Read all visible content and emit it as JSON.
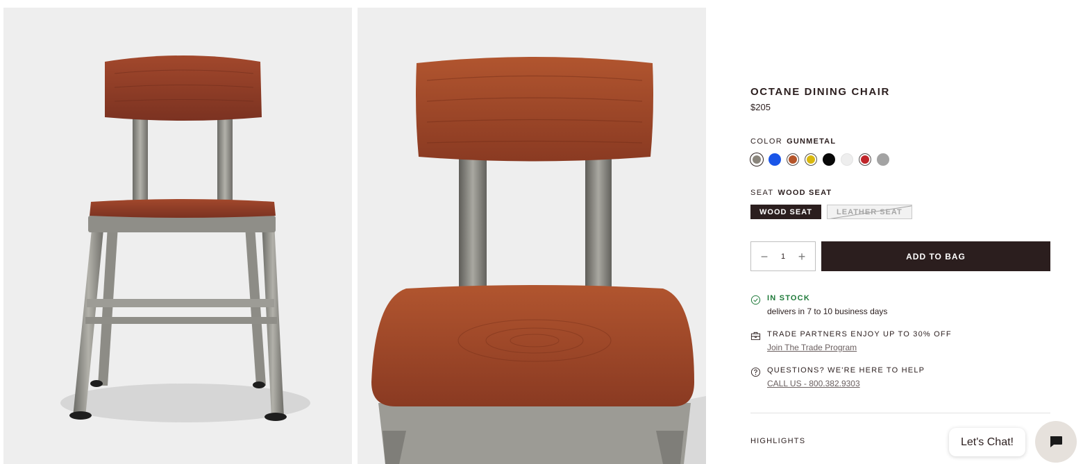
{
  "product": {
    "title": "OCTANE DINING CHAIR",
    "price": "$205"
  },
  "color_option": {
    "label": "COLOR",
    "selected": "GUNMETAL",
    "swatches": [
      {
        "name": "gunmetal",
        "color": "#8a857c",
        "selected": true
      },
      {
        "name": "blue",
        "color": "#1a55e8"
      },
      {
        "name": "copper",
        "color": "#b5552a"
      },
      {
        "name": "yellow",
        "color": "#d9b80f"
      },
      {
        "name": "black",
        "color": "#080808"
      },
      {
        "name": "white",
        "color": "#eeeeee"
      },
      {
        "name": "red",
        "color": "#c0252a"
      },
      {
        "name": "gray",
        "color": "#a3a3a3"
      }
    ]
  },
  "seat_option": {
    "label": "SEAT",
    "selected": "WOOD SEAT",
    "choices": [
      "WOOD SEAT",
      "LEATHER SEAT"
    ]
  },
  "purchase": {
    "quantity": "1",
    "minus": "−",
    "plus": "+",
    "add_label": "ADD TO BAG"
  },
  "stock": {
    "status": "IN STOCK",
    "delivery": "delivers in 7 to 10 business days"
  },
  "trade": {
    "headline": "TRADE PARTNERS ENJOY UP TO 30% OFF",
    "link": "Join The Trade Program"
  },
  "help": {
    "headline": "QUESTIONS? WE'RE HERE TO HELP",
    "link": "CALL US - 800.382.9303"
  },
  "sections": {
    "highlights": "HIGHLIGHTS"
  },
  "chat": {
    "label": "Let's Chat!"
  },
  "colors": {
    "brand_dark": "#2b1e1e",
    "in_stock": "#1f7a3a"
  }
}
